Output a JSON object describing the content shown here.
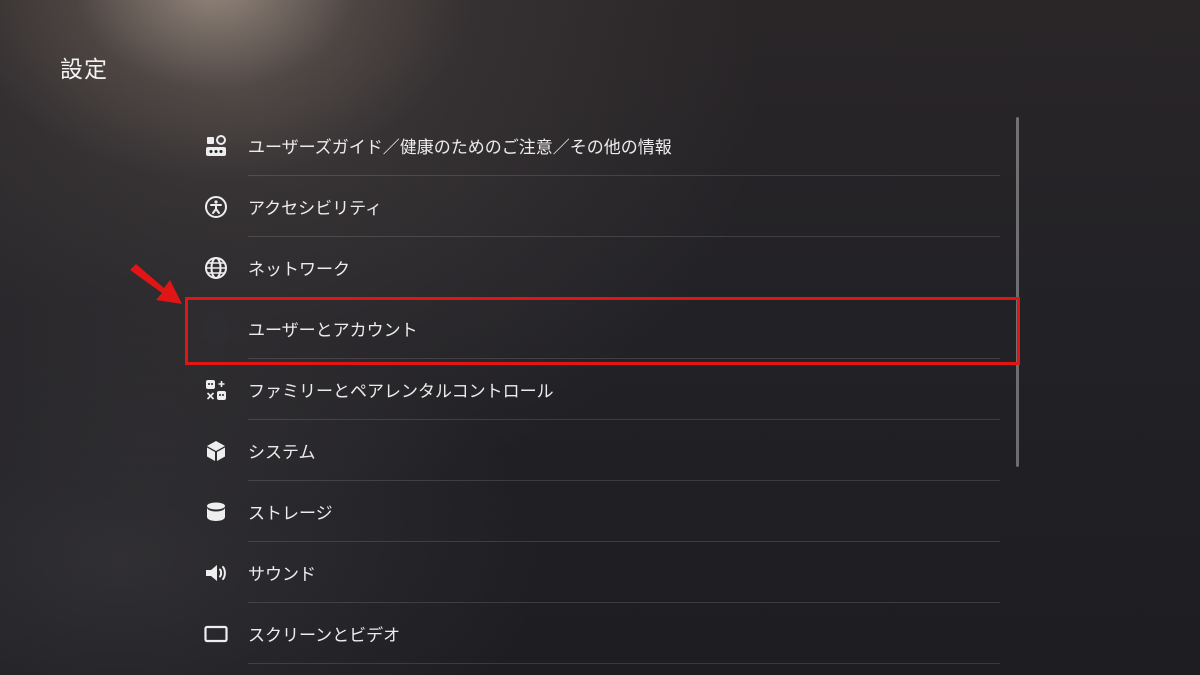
{
  "header": {
    "title": "設定"
  },
  "menu": {
    "items": [
      {
        "label": "ユーザーズガイド／健康のためのご注意／その他の情報",
        "icon": "user-guide-icon"
      },
      {
        "label": "アクセシビリティ",
        "icon": "accessibility-icon"
      },
      {
        "label": "ネットワーク",
        "icon": "globe-icon"
      },
      {
        "label": "ユーザーとアカウント",
        "icon": "avatar-icon"
      },
      {
        "label": "ファミリーとペアレンタルコントロール",
        "icon": "family-icon"
      },
      {
        "label": "システム",
        "icon": "cube-icon"
      },
      {
        "label": "ストレージ",
        "icon": "storage-icon"
      },
      {
        "label": "サウンド",
        "icon": "speaker-icon"
      },
      {
        "label": "スクリーンとビデオ",
        "icon": "screen-icon"
      }
    ]
  },
  "annotation": {
    "highlight_color": "#e01515",
    "arrow_color": "#e01515"
  }
}
